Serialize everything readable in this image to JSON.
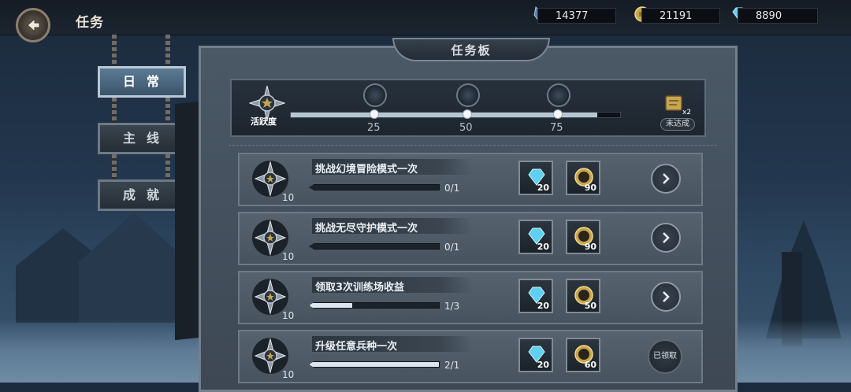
{
  "header": {
    "title": "任务",
    "resources": [
      {
        "icon": "crystal-shard-icon",
        "value": "14377"
      },
      {
        "icon": "gold-coin-icon",
        "value": "21191"
      },
      {
        "icon": "diamond-gem-icon",
        "value": "8890"
      }
    ]
  },
  "side_tabs": [
    {
      "label": "日常",
      "active": true
    },
    {
      "label": "主线",
      "active": false
    },
    {
      "label": "成就",
      "active": false
    }
  ],
  "board": {
    "title": "任务板",
    "activity": {
      "label": "活跃度",
      "progress": 0.93,
      "milestones": [
        "25",
        "50",
        "75"
      ],
      "final_reward_multiplier": "x2",
      "status": "未达成"
    }
  },
  "quests": [
    {
      "title": "挑战幻境冒险模式一次",
      "points": "10",
      "progress_text": "0/1",
      "progress": 0,
      "rewards": [
        {
          "icon": "diamond-gem-icon",
          "amount": "20"
        },
        {
          "icon": "exp-coin-icon",
          "amount": "90"
        }
      ],
      "action": "go"
    },
    {
      "title": "挑战无尽守护模式一次",
      "points": "10",
      "progress_text": "0/1",
      "progress": 0,
      "rewards": [
        {
          "icon": "diamond-gem-icon",
          "amount": "20"
        },
        {
          "icon": "exp-coin-icon",
          "amount": "90"
        }
      ],
      "action": "go"
    },
    {
      "title": "领取3次训练场收益",
      "points": "10",
      "progress_text": "1/3",
      "progress": 0.33,
      "rewards": [
        {
          "icon": "diamond-gem-icon",
          "amount": "20"
        },
        {
          "icon": "exp-coin-icon",
          "amount": "50"
        }
      ],
      "action": "go"
    },
    {
      "title": "升级任意兵种一次",
      "points": "10",
      "progress_text": "2/1",
      "progress": 1,
      "rewards": [
        {
          "icon": "diamond-gem-icon",
          "amount": "20"
        },
        {
          "icon": "exp-coin-icon",
          "amount": "60"
        }
      ],
      "action": "claimed",
      "action_label": "已领取"
    }
  ],
  "colors": {
    "accent": "#b7c6d3",
    "panel": "#47535e",
    "gem": "#5fd0f0",
    "coin": "#c8a650"
  }
}
